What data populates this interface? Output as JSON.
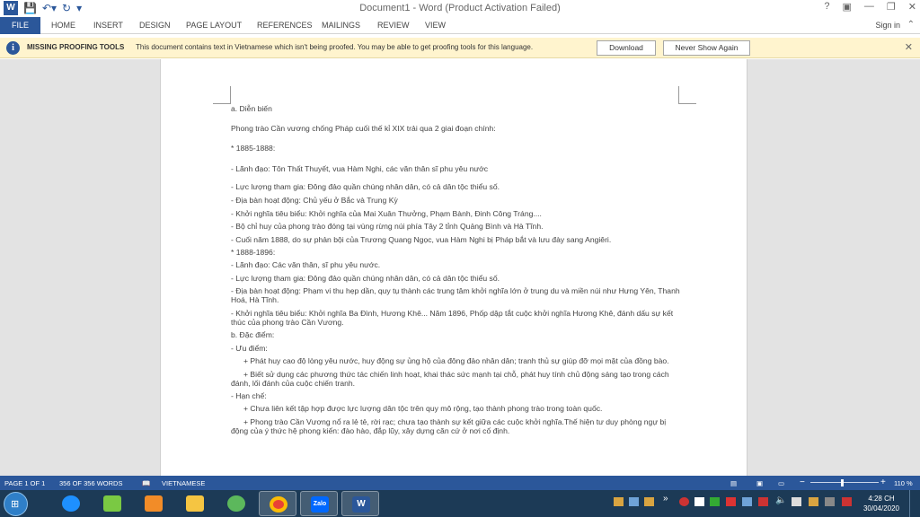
{
  "titlebar": {
    "title": "Document1 - Word (Product Activation Failed)",
    "help_icon": "?",
    "ribbon_display_icon": "▣",
    "minimize_icon": "—",
    "restore_icon": "❐",
    "close_icon": "✕"
  },
  "tabs": [
    "FILE",
    "HOME",
    "INSERT",
    "DESIGN",
    "PAGE LAYOUT",
    "REFERENCES",
    "MAILINGS",
    "REVIEW",
    "VIEW"
  ],
  "signin": "Sign in",
  "message_bar": {
    "title": "MISSING PROOFING TOOLS",
    "text": "This document contains text in Vietnamese which isn't being proofed. You may be able to get proofing tools for this language.",
    "download_label": "Download",
    "never_show_label": "Never Show Again"
  },
  "document": {
    "paragraphs": [
      "a. Diễn biến",
      "Phong trào Cần vương chống Pháp cuối thế kỉ XIX trải qua 2 giai đoạn chính:",
      "* 1885-1888:",
      "- Lãnh đạo: Tôn Thất Thuyết, vua Hàm Nghi, các văn thân sĩ phu yêu nước",
      "- Lực lượng tham gia: Đông đảo quần chúng nhân dân, có cả dân tộc thiểu số.",
      "- Địa bàn hoạt động: Chủ yếu ở Bắc và Trung Kỳ",
      "- Khởi nghĩa tiêu biểu: Khởi nghĩa của Mai Xuân Thưởng, Phạm Bành, Đinh Công Tráng....",
      "- Bộ chỉ huy của phong trào đóng tại vùng rừng núi phía Tây 2 tỉnh Quảng Bình và Hà Tĩnh.",
      "- Cuối năm 1888, do sự phản bội của Trương Quang Ngọc, vua Hàm Nghi bị Pháp bắt và lưu đày sang Angiêri.",
      "* 1888-1896:",
      "- Lãnh đạo: Các văn thân, sĩ phu yêu nước.",
      "- Lực lượng tham gia: Đông đảo quần chúng nhân dân, có cả dân tộc thiểu số.",
      "- Địa bàn hoạt động: Phạm vi thu hẹp dần, quy tụ thành các trung tâm khởi nghĩa lớn ở trung du và miền núi như Hưng Yên, Thanh Hoá, Hà Tĩnh.",
      "- Khởi nghĩa tiêu biểu: Khởi nghĩa Ba Đình, Hương Khê... Năm 1896, Phốp dập tắt cuộc khởi nghĩa Hương Khê, đánh dấu sự kết thúc của phong trào Cần Vương.",
      "b. Đặc điểm:",
      "- Ưu điểm:",
      "+ Phát huy cao độ lòng yêu nước, huy động sự ủng hộ của đông đảo nhân dân; tranh thủ sự giúp đỡ mọi mặt của đồng bào.",
      "+ Biết sử dụng các phương thức tác chiến linh hoạt, khai thác sức mạnh tại chỗ, phát huy tính chủ động sáng tạo trong cách đánh, lối đánh của cuộc chiến tranh.",
      "- Hạn chế:",
      "+ Chưa liên kết tập hợp được lực lượng dân tộc trên quy mô rộng, tạo thành phong trào trong toàn quốc.",
      "+ Phong trào Cần Vương nổ ra lẻ tẻ, rời rạc; chưa tạo thành sự kết giữa các cuộc khởi nghĩa.Thế hiện tư duy phòng ngự bị động của ý thức hệ phong kiến: đào hào, đắp lũy, xây dựng căn cứ ở nơi cố định."
    ]
  },
  "statusbar": {
    "page": "PAGE 1 OF 1",
    "words": "356 OF 356 WORDS",
    "language": "VIETNAMESE",
    "zoom": "110 %",
    "zoom_percent": 110,
    "minus": "−",
    "plus": "+"
  },
  "taskbar": {
    "time": "4:28 CH",
    "date": "30/04/2020",
    "zalo_label": "Zalo",
    "apps": [
      "ie-icon",
      "bluestacks-icon",
      "media-player-icon",
      "file-explorer-icon",
      "coccoc-icon",
      "chrome-icon",
      "zalo-icon",
      "word-icon"
    ]
  },
  "colors": {
    "accent": "#2b579a",
    "message_bar": "#fff4ce",
    "taskbar": "#1c3a56"
  }
}
